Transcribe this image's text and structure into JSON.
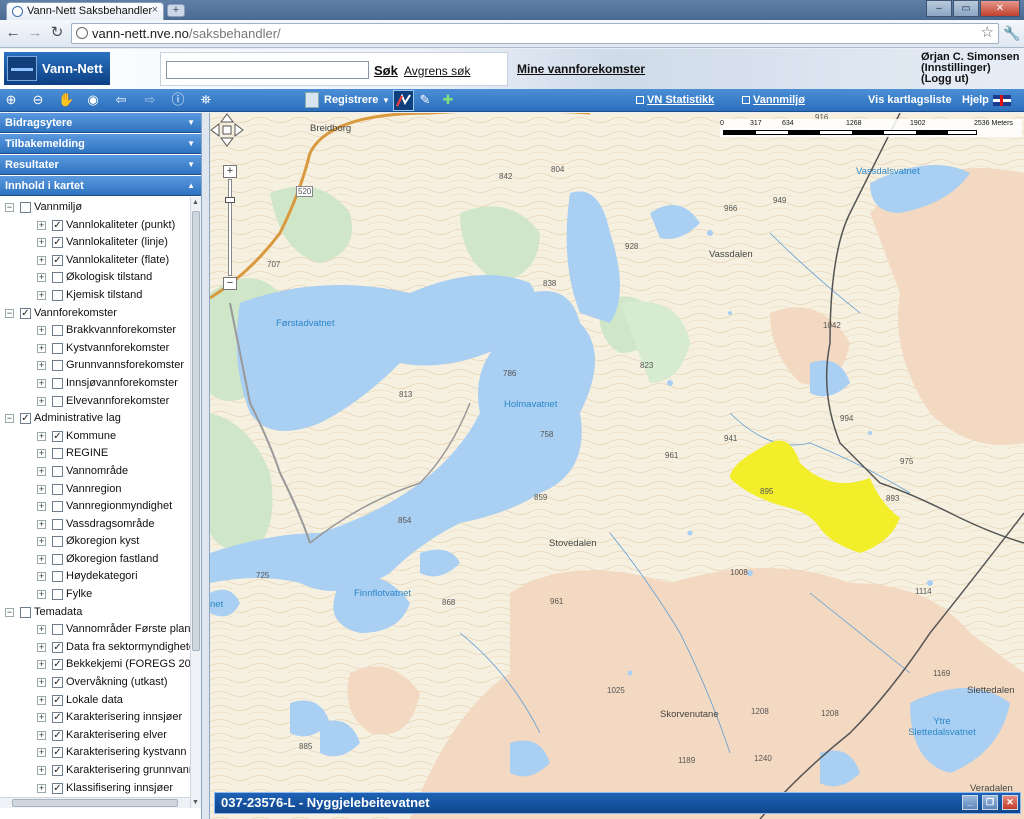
{
  "browser": {
    "tab_title": "Vann-Nett Saksbehandler",
    "tab_close": "×",
    "new_tab": "+",
    "url_host": "vann-nett.nve.no",
    "url_path": "/saksbehandler/",
    "window_min": "–",
    "window_max": "▭",
    "window_close": "✕"
  },
  "header": {
    "logo_text": "Vann-Nett",
    "search_placeholder": "",
    "search_button": "Søk",
    "refine_link": "Avgrens søk",
    "my_waterbodies": "Mine vannforekomster",
    "user_name": "Ørjan C. Simonsen",
    "settings_link": "(Innstillinger)",
    "logout_link": "(Logg ut)"
  },
  "maptoolbar": {
    "register_menu": "Registrere",
    "vn_statistics": "VN Statistikk",
    "vannmiljo": "Vannmiljø",
    "layer_list": "Vis kartlagsliste",
    "help": "Hjelp"
  },
  "panel": {
    "sections": [
      {
        "label": "Bidragsytere",
        "arrow": "▼"
      },
      {
        "label": "Tilbakemelding",
        "arrow": "▼"
      },
      {
        "label": "Resultater",
        "arrow": "▼"
      },
      {
        "label": "Innhold i kartet",
        "arrow": "▲"
      }
    ],
    "tree": [
      {
        "label": "Vannmiljø",
        "level": 0,
        "checked": false,
        "expanded": true
      },
      {
        "label": "Vannlokaliteter (punkt)",
        "level": 1,
        "checked": true
      },
      {
        "label": "Vannlokaliteter (linje)",
        "level": 1,
        "checked": true
      },
      {
        "label": "Vannlokaliteter (flate)",
        "level": 1,
        "checked": true
      },
      {
        "label": "Økologisk tilstand",
        "level": 1,
        "checked": false
      },
      {
        "label": "Kjemisk tilstand",
        "level": 1,
        "checked": false
      },
      {
        "label": "Vannforekomster",
        "level": 0,
        "checked": true,
        "expanded": true
      },
      {
        "label": "Brakkvannforekomster",
        "level": 1,
        "checked": false
      },
      {
        "label": "Kystvannforekomster",
        "level": 1,
        "checked": false
      },
      {
        "label": "Grunnvannsforekomster",
        "level": 1,
        "checked": false
      },
      {
        "label": "Innsjøvannforekomster",
        "level": 1,
        "checked": false
      },
      {
        "label": "Elvevannforekomster",
        "level": 1,
        "checked": false
      },
      {
        "label": "Administrative lag",
        "level": 0,
        "checked": true,
        "expanded": true
      },
      {
        "label": "Kommune",
        "level": 1,
        "checked": true
      },
      {
        "label": "REGINE",
        "level": 1,
        "checked": false
      },
      {
        "label": "Vannområde",
        "level": 1,
        "checked": false
      },
      {
        "label": "Vannregion",
        "level": 1,
        "checked": false
      },
      {
        "label": "Vannregionmyndighet",
        "level": 1,
        "checked": false
      },
      {
        "label": "Vassdragsområde",
        "level": 1,
        "checked": false
      },
      {
        "label": "Økoregion kyst",
        "level": 1,
        "checked": false
      },
      {
        "label": "Økoregion fastland",
        "level": 1,
        "checked": false
      },
      {
        "label": "Høydekategori",
        "level": 1,
        "checked": false
      },
      {
        "label": "Fylke",
        "level": 1,
        "checked": false
      },
      {
        "label": "Temadata",
        "level": 0,
        "checked": false,
        "expanded": true
      },
      {
        "label": "Vannområder Første planfa",
        "level": 1,
        "checked": false
      },
      {
        "label": "Data fra sektormyndighete",
        "level": 1,
        "checked": true
      },
      {
        "label": "Bekkekjemi (FOREGS 2008",
        "level": 1,
        "checked": true
      },
      {
        "label": "Overvåkning (utkast)",
        "level": 1,
        "checked": true
      },
      {
        "label": "Lokale data",
        "level": 1,
        "checked": true
      },
      {
        "label": "Karakterisering innsjøer",
        "level": 1,
        "checked": true
      },
      {
        "label": "Karakterisering elver",
        "level": 1,
        "checked": true
      },
      {
        "label": "Karakterisering kystvann",
        "level": 1,
        "checked": true
      },
      {
        "label": "Karakterisering grunnvann",
        "level": 1,
        "checked": true
      },
      {
        "label": "Klassifisering innsjøer",
        "level": 1,
        "checked": true
      }
    ]
  },
  "map": {
    "scale_ticks": [
      "0",
      "317",
      "634",
      "1268",
      "1902",
      "2536 Meters"
    ],
    "road_number": "520",
    "water_labels": [
      "Førstadvatnet",
      "Holmavatnet",
      "Finnflotvatnet",
      "Vassdalsvatnet",
      "Ytre Slettedalsvatnet",
      "net"
    ],
    "place_labels": [
      "Breidborg",
      "Vassdalen",
      "Stovedalen",
      "Skorvenutane",
      "Slettedalen",
      "Veradalen"
    ],
    "elevations": [
      "842",
      "804",
      "916",
      "966",
      "949",
      "928",
      "707",
      "838",
      "1042",
      "823",
      "786",
      "813",
      "941",
      "994",
      "975",
      "961",
      "758",
      "893",
      "895",
      "859",
      "854",
      "725",
      "1008",
      "868",
      "961",
      "1114",
      "1169",
      "1025",
      "1208",
      "1208",
      "885",
      "1189",
      "1240",
      "1188"
    ],
    "selected_feature": "037-23576-L - Nyggjelebeitevatnet",
    "highlight_color": "#f2ee2a",
    "water_color": "#a9cff2",
    "forest_color": "#cfe6c9",
    "bare_rock_color": "#f3d9c1"
  }
}
